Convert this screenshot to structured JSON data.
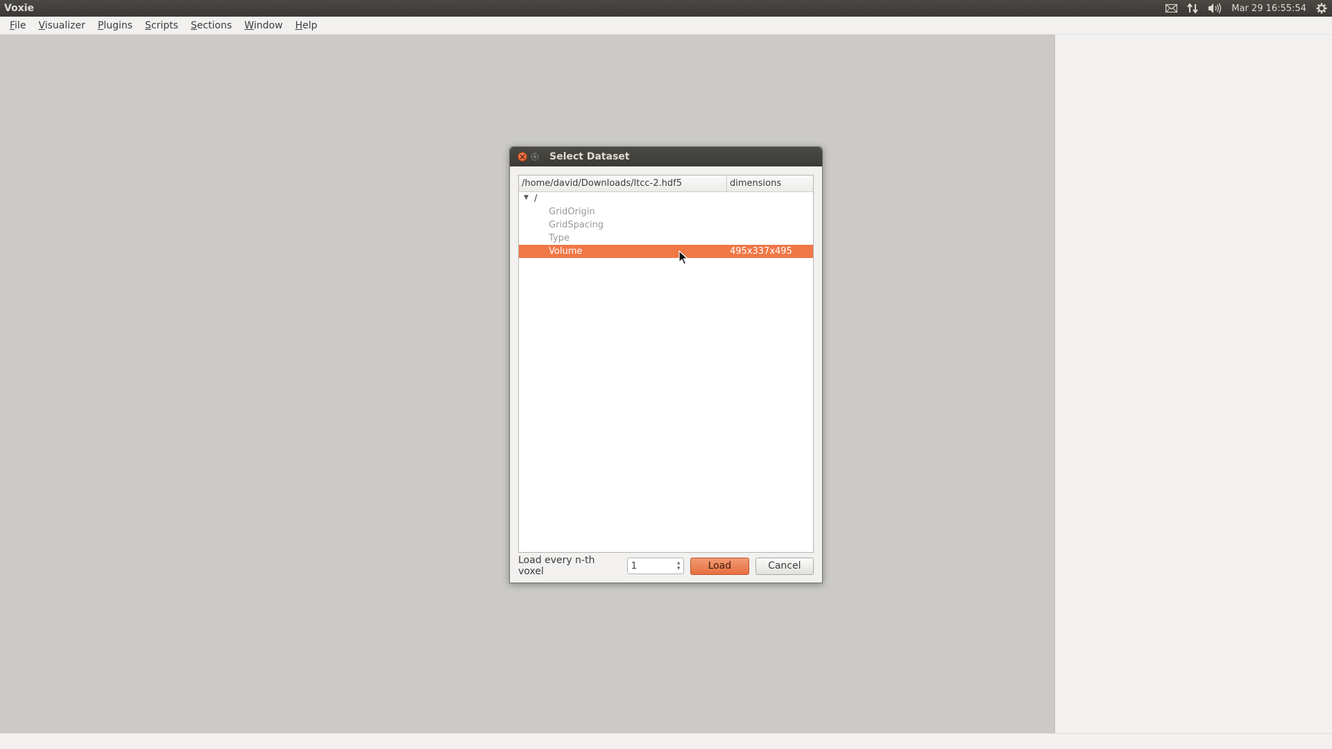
{
  "top_panel": {
    "app_title": "Voxie",
    "clock": "Mar 29 16:55:54",
    "indicators": [
      "mail-icon",
      "network-icon",
      "volume-icon",
      "system-gear-icon"
    ]
  },
  "menubar": {
    "items": [
      "File",
      "Visualizer",
      "Plugins",
      "Scripts",
      "Sections",
      "Window",
      "Help"
    ]
  },
  "dialog": {
    "title": "Select Dataset",
    "tree": {
      "columns": [
        "/home/david/Downloads/ltcc-2.hdf5",
        "dimensions"
      ],
      "root": "/",
      "rows": [
        {
          "name": "GridOrigin",
          "dimensions": ""
        },
        {
          "name": "GridSpacing",
          "dimensions": ""
        },
        {
          "name": "Type",
          "dimensions": ""
        },
        {
          "name": "Volume",
          "dimensions": "495x337x495",
          "selected": true
        }
      ]
    },
    "nth_voxel_label": "Load every n-th voxel",
    "nth_voxel_value": "1",
    "load_label": "Load",
    "cancel_label": "Cancel"
  },
  "colors": {
    "accent": "#f07746",
    "panel_dark": "#3c3b37",
    "background": "#cbcac7"
  }
}
